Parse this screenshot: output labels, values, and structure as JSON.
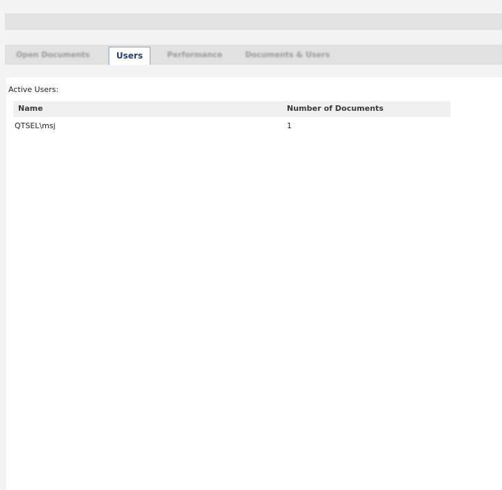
{
  "tabs": [
    {
      "label": "Open Documents",
      "active": false
    },
    {
      "label": "Users",
      "active": true
    },
    {
      "label": "Performance",
      "active": false
    },
    {
      "label": "Documents & Users",
      "active": false
    }
  ],
  "section_label": "Active Users:",
  "table": {
    "columns": [
      "Name",
      "Number of Documents"
    ],
    "rows": [
      {
        "name": "QTSEL\\msj",
        "documents": "1"
      }
    ]
  }
}
